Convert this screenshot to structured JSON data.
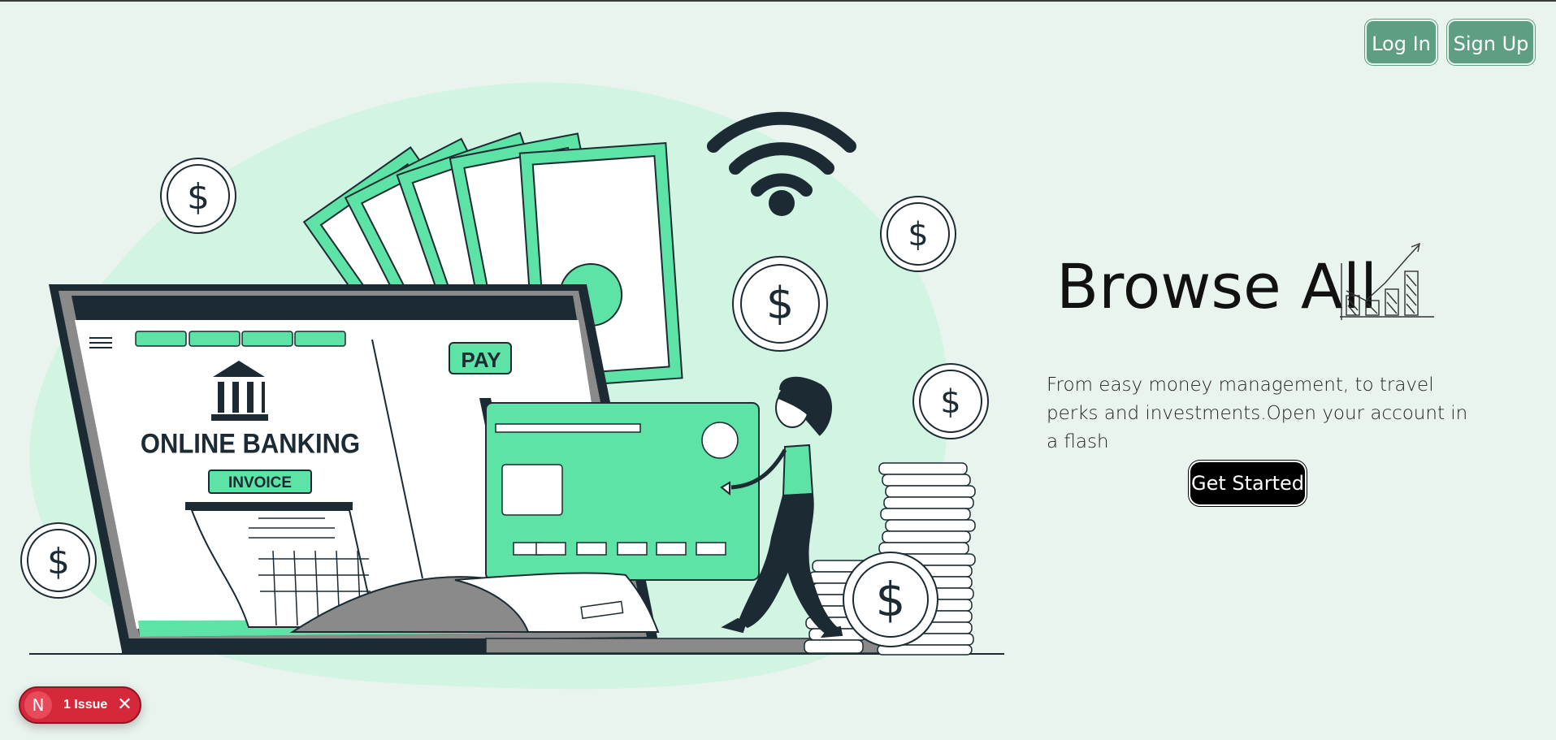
{
  "header": {
    "login_label": "Log In",
    "signup_label": "Sign Up"
  },
  "hero": {
    "title": "Browse All",
    "subtitle": "From easy money management, to travel perks and investments.Open your account in a flash",
    "cta_label": "Get Started"
  },
  "illustration": {
    "screen_heading": "ONLINE BANKING",
    "invoice_label": "INVOICE",
    "pay_label": "PAY",
    "coin_symbol": "$"
  },
  "dev_overlay": {
    "avatar_letter": "N",
    "issue_label": "1 Issue",
    "close_glyph": "✕"
  },
  "colors": {
    "background": "#eaf4ee",
    "accent_green": "#5de3a6",
    "button_green": "#5e9e83",
    "dark": "#1c2b33",
    "issue_red": "#d5283a"
  },
  "icons": [
    "wifi-icon",
    "dollar-coin-icon",
    "bank-icon",
    "menu-icon",
    "growth-chart-icon",
    "close-icon"
  ]
}
